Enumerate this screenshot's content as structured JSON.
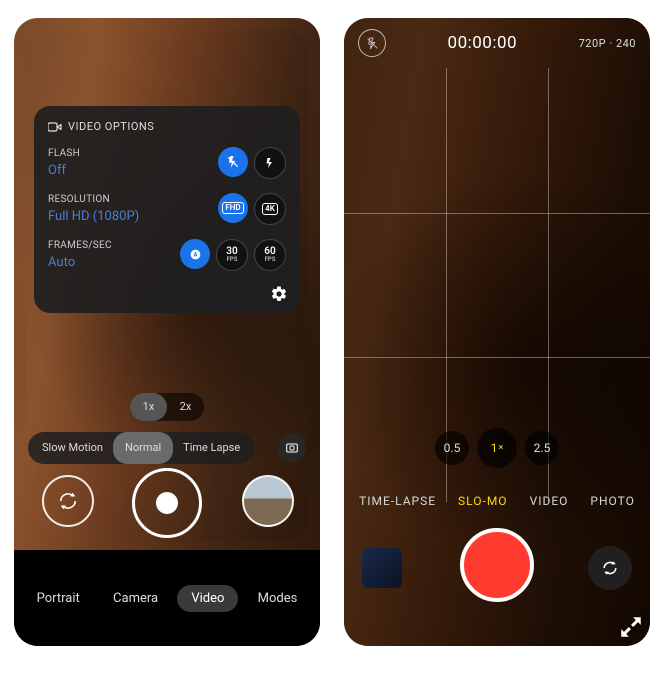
{
  "left": {
    "panel": {
      "header": "VIDEO OPTIONS",
      "flash": {
        "label": "FLASH",
        "value": "Off",
        "options": [
          "flash-off",
          "flash-on"
        ],
        "selected": 0
      },
      "resolution": {
        "label": "RESOLUTION",
        "value": "Full HD (1080P)",
        "options": [
          "FHD",
          "4K"
        ],
        "selected": 0
      },
      "fps": {
        "label": "FRAMES/SEC",
        "value": "Auto",
        "options": [
          "auto",
          "30",
          "60"
        ],
        "selected": 0
      }
    },
    "zoom": {
      "options": [
        "1x",
        "2x"
      ],
      "selected": 0
    },
    "speedModes": {
      "options": [
        "Slow Motion",
        "Normal",
        "Time Lapse"
      ],
      "selected": 1
    },
    "tabs": {
      "options": [
        "Portrait",
        "Camera",
        "Video",
        "Modes"
      ],
      "selected": 2
    }
  },
  "right": {
    "timer": "00:00:00",
    "resolution": "720P · 240",
    "zoom": {
      "options": [
        "0.5",
        "1",
        "2.5"
      ],
      "selected": 1
    },
    "modes": {
      "options": [
        "TIME-LAPSE",
        "SLO-MO",
        "VIDEO",
        "PHOTO"
      ],
      "selected": 1
    }
  }
}
